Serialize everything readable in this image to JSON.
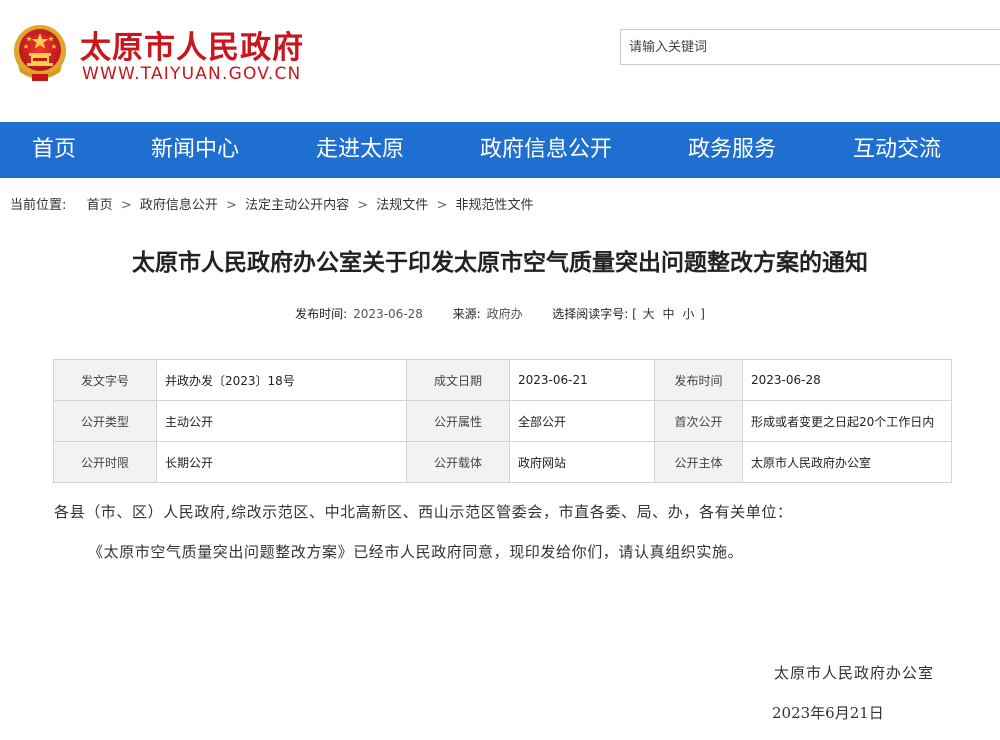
{
  "header": {
    "site_title": "太原市人民政府",
    "site_domain": "WWW.TAIYUAN.GOV.CN",
    "search_placeholder": "请输入关键词"
  },
  "nav": {
    "items": [
      "首页",
      "新闻中心",
      "走进太原",
      "政府信息公开",
      "政务服务",
      "互动交流"
    ]
  },
  "breadcrumb": {
    "label": "当前位置:",
    "items": [
      "首页",
      "政府信息公开",
      "法定主动公开内容",
      "法规文件",
      "非规范性文件"
    ],
    "separator": ">"
  },
  "article": {
    "title": "太原市人民政府办公室关于印发太原市空气质量突出问题整改方案的通知",
    "meta": {
      "publish_label": "发布时间:",
      "publish_value": "2023-06-28",
      "source_label": "来源:",
      "source_value": "政府办",
      "fontsize_label": "选择阅读字号:",
      "fontsize_open": "[",
      "fontsize_large": "大",
      "fontsize_medium": "中",
      "fontsize_small": "小",
      "fontsize_close": "]"
    },
    "info_table": {
      "rows": [
        [
          {
            "label": "发文字号",
            "value": "并政办发〔2023〕18号"
          },
          {
            "label": "成文日期",
            "value": "2023-06-21"
          },
          {
            "label": "发布时间",
            "value": "2023-06-28"
          }
        ],
        [
          {
            "label": "公开类型",
            "value": "主动公开"
          },
          {
            "label": "公开属性",
            "value": "全部公开"
          },
          {
            "label": "首次公开",
            "value": "形成或者变更之日起20个工作日内"
          }
        ],
        [
          {
            "label": "公开时限",
            "value": "长期公开"
          },
          {
            "label": "公开载体",
            "value": "政府网站"
          },
          {
            "label": "公开主体",
            "value": "太原市人民政府办公室"
          }
        ]
      ]
    },
    "salutation": "各县（市、区）人民政府,综改示范区、中北高新区、西山示范区管委会，市直各委、局、办，各有关单位：",
    "paragraph": "《太原市空气质量突出问题整改方案》已经市人民政府同意，现印发给你们，请认真组织实施。",
    "signature": "太原市人民政府办公室",
    "date": "2023年6月21日"
  },
  "colors": {
    "brand_red": "#c8161d",
    "nav_blue": "#1e6fd0"
  }
}
